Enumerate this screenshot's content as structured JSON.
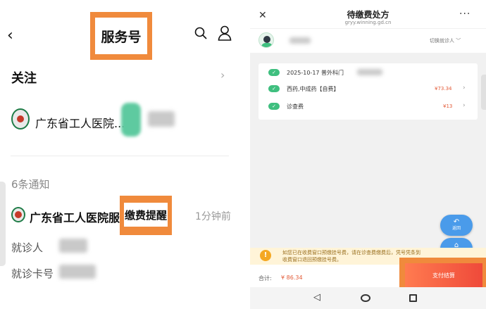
{
  "left": {
    "header": {
      "title": "服务号"
    },
    "follow": {
      "label": "关注"
    },
    "account": {
      "name": "广东省工人医院..."
    },
    "notices": {
      "count_label": "6条通知",
      "message": {
        "sender": "广东省工人医院服务号:",
        "keyword": "缴费提醒",
        "time": "1分钟前",
        "fields": [
          {
            "label": "就诊人"
          },
          {
            "label": "就诊卡号"
          }
        ]
      }
    }
  },
  "right": {
    "header": {
      "title": "待缴费处方",
      "url": "gryy.winning.gd.cn",
      "more": "···"
    },
    "patient": {
      "switch_label": "切换就诊人"
    },
    "items": [
      {
        "text": "2025-10-17 普外科门",
        "price": ""
      },
      {
        "text": "西药,中成药【自费】",
        "price": "¥73.34"
      },
      {
        "text": "诊查费",
        "price": "¥13"
      }
    ],
    "notice": "如您已在收费窗口预缴挂号费，请在诊查费缴费后，凭号凭条到收费窗口退回预缴挂号费。",
    "total": {
      "label": "合计:",
      "value": "¥ 86.34"
    },
    "pay_button": "支付结算",
    "fabs": {
      "back": "返回",
      "home": "首页"
    }
  }
}
